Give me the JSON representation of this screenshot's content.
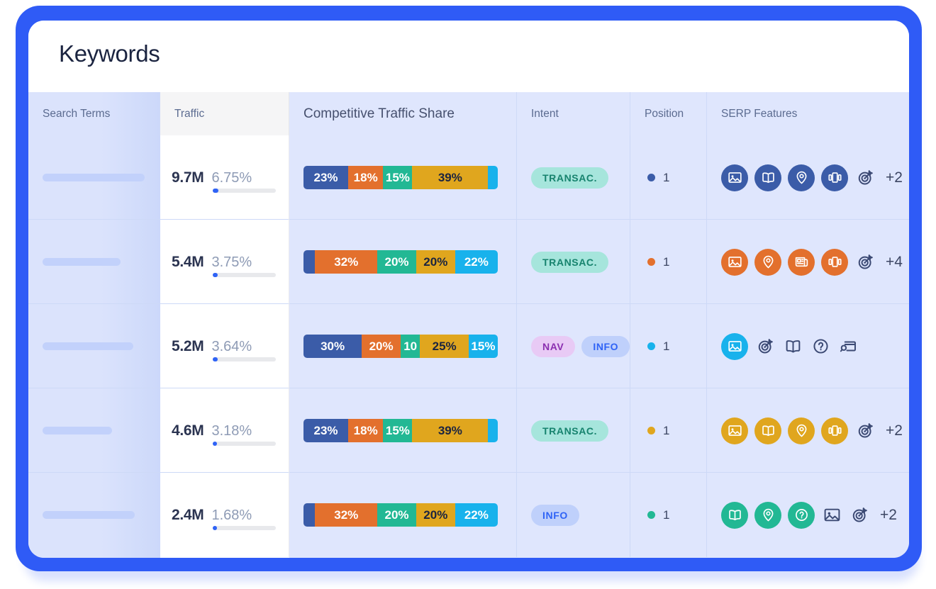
{
  "window": {
    "title": "Keywords",
    "frame_color": "#2F5BF6",
    "card_bg": "#FFFFFF",
    "table_bg": "#DFE6FD"
  },
  "table": {
    "columns": [
      {
        "key": "search_terms",
        "label": "Search Terms"
      },
      {
        "key": "traffic",
        "label": "Traffic"
      },
      {
        "key": "share",
        "label": "Competitive Traffic Share"
      },
      {
        "key": "intent",
        "label": "Intent"
      },
      {
        "key": "position",
        "label": "Position"
      },
      {
        "key": "serp",
        "label": "SERP Features"
      }
    ],
    "rows": [
      {
        "placeholder_width": 144,
        "traffic_value": "9.7M",
        "traffic_pct": "6.75%",
        "traffic_fill_pct": 9,
        "share_segments": [
          {
            "label": "23%",
            "pct": 23,
            "color": "#3B5CA8",
            "text": "#FFFFFF"
          },
          {
            "label": "18%",
            "pct": 18,
            "color": "#E3702D",
            "text": "#FFFFFF"
          },
          {
            "label": "15%",
            "pct": 15,
            "color": "#22B894",
            "text": "#FFFFFF"
          },
          {
            "label": "39%",
            "pct": 39,
            "color": "#E0A61E",
            "text": "#1B2440"
          },
          {
            "label": "",
            "pct": 5,
            "color": "#18B2EC",
            "text": "#FFFFFF"
          }
        ],
        "intents": [
          {
            "label": "TRANSAC.",
            "bg": "#A6E5DC",
            "fg": "#17836E"
          }
        ],
        "position": "1",
        "position_dot": "#3B5CA8",
        "serp_chip_color": "#3B5CA8",
        "serp_filled": [
          "image-icon",
          "book-icon",
          "map-pin-icon",
          "carousel-icon"
        ],
        "serp_outline": [
          "target-icon"
        ],
        "serp_more": "+2"
      },
      {
        "placeholder_width": 110,
        "traffic_value": "5.4M",
        "traffic_pct": "3.75%",
        "traffic_fill_pct": 8,
        "share_segments": [
          {
            "label": "",
            "pct": 6,
            "color": "#3B5CA8",
            "text": "#FFFFFF"
          },
          {
            "label": "32%",
            "pct": 32,
            "color": "#E3702D",
            "text": "#FFFFFF"
          },
          {
            "label": "20%",
            "pct": 20,
            "color": "#22B894",
            "text": "#FFFFFF"
          },
          {
            "label": "20%",
            "pct": 20,
            "color": "#E0A61E",
            "text": "#1B2440"
          },
          {
            "label": "22%",
            "pct": 22,
            "color": "#18B2EC",
            "text": "#FFFFFF"
          }
        ],
        "intents": [
          {
            "label": "TRANSAC.",
            "bg": "#A6E5DC",
            "fg": "#17836E"
          }
        ],
        "position": "1",
        "position_dot": "#E3702D",
        "serp_chip_color": "#E3702D",
        "serp_filled": [
          "image-icon",
          "map-pin-icon",
          "news-icon",
          "carousel-icon"
        ],
        "serp_outline": [
          "target-icon"
        ],
        "serp_more": "+4"
      },
      {
        "placeholder_width": 128,
        "traffic_value": "5.2M",
        "traffic_pct": "3.64%",
        "traffic_fill_pct": 8,
        "share_segments": [
          {
            "label": "30%",
            "pct": 30,
            "color": "#3B5CA8",
            "text": "#FFFFFF"
          },
          {
            "label": "20%",
            "pct": 20,
            "color": "#E3702D",
            "text": "#FFFFFF"
          },
          {
            "label": "10",
            "pct": 10,
            "color": "#22B894",
            "text": "#FFFFFF"
          },
          {
            "label": "25%",
            "pct": 25,
            "color": "#E0A61E",
            "text": "#1B2440"
          },
          {
            "label": "15%",
            "pct": 15,
            "color": "#18B2EC",
            "text": "#FFFFFF"
          }
        ],
        "intents": [
          {
            "label": "NAV",
            "bg": "#E8CAF5",
            "fg": "#8B2FB0"
          },
          {
            "label": "INFO",
            "bg": "#BFD0FB",
            "fg": "#2F63F6"
          }
        ],
        "position": "1",
        "position_dot": "#18B2EC",
        "serp_chip_color": "#18B2EC",
        "serp_filled": [
          "image-icon"
        ],
        "serp_outline": [
          "target-icon",
          "book-icon",
          "question-icon",
          "search-window-icon"
        ],
        "serp_more": ""
      },
      {
        "placeholder_width": 98,
        "traffic_value": "4.6M",
        "traffic_pct": "3.18%",
        "traffic_fill_pct": 7,
        "share_segments": [
          {
            "label": "23%",
            "pct": 23,
            "color": "#3B5CA8",
            "text": "#FFFFFF"
          },
          {
            "label": "18%",
            "pct": 18,
            "color": "#E3702D",
            "text": "#FFFFFF"
          },
          {
            "label": "15%",
            "pct": 15,
            "color": "#22B894",
            "text": "#FFFFFF"
          },
          {
            "label": "39%",
            "pct": 39,
            "color": "#E0A61E",
            "text": "#1B2440"
          },
          {
            "label": "",
            "pct": 5,
            "color": "#18B2EC",
            "text": "#FFFFFF"
          }
        ],
        "intents": [
          {
            "label": "TRANSAC.",
            "bg": "#A6E5DC",
            "fg": "#17836E"
          }
        ],
        "position": "1",
        "position_dot": "#E0A61E",
        "serp_chip_color": "#E0A61E",
        "serp_filled": [
          "image-icon",
          "book-icon",
          "map-pin-icon",
          "carousel-icon"
        ],
        "serp_outline": [
          "target-icon"
        ],
        "serp_more": "+2"
      },
      {
        "placeholder_width": 130,
        "traffic_value": "2.4M",
        "traffic_pct": "1.68%",
        "traffic_fill_pct": 6,
        "share_segments": [
          {
            "label": "",
            "pct": 6,
            "color": "#3B5CA8",
            "text": "#FFFFFF"
          },
          {
            "label": "32%",
            "pct": 32,
            "color": "#E3702D",
            "text": "#FFFFFF"
          },
          {
            "label": "20%",
            "pct": 20,
            "color": "#22B894",
            "text": "#FFFFFF"
          },
          {
            "label": "20%",
            "pct": 20,
            "color": "#E0A61E",
            "text": "#1B2440"
          },
          {
            "label": "22%",
            "pct": 22,
            "color": "#18B2EC",
            "text": "#FFFFFF"
          }
        ],
        "intents": [
          {
            "label": "INFO",
            "bg": "#BFD0FB",
            "fg": "#2F63F6"
          }
        ],
        "position": "1",
        "position_dot": "#22B894",
        "serp_chip_color": "#22B894",
        "serp_filled": [
          "book-icon",
          "map-pin-icon",
          "question-icon"
        ],
        "serp_outline": [
          "image-icon",
          "target-icon"
        ],
        "serp_more": "+2"
      }
    ]
  }
}
